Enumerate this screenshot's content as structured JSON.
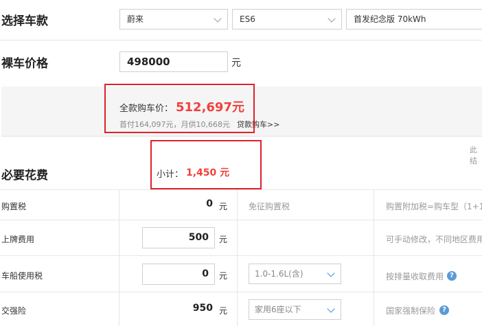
{
  "select_car": {
    "heading": "选择车款",
    "brand": "蔚来",
    "model": "ES6",
    "trim": "首发纪念版 70kWh"
  },
  "bare_price": {
    "heading": "裸车价格",
    "value": "498000",
    "unit": "元"
  },
  "summary": {
    "full_price_label": "全款购车价：",
    "full_price_value": "512,697元",
    "detail": "首付164,097元，月供10,668元",
    "loan_link": "贷款购车>>",
    "right_text": "此结"
  },
  "required": {
    "heading": "必要花费",
    "subtotal_label": "小计：",
    "subtotal_value": "1,450 元"
  },
  "rows": [
    {
      "label": "购置税",
      "value": "0",
      "unit": "元",
      "middle": "免征购置税",
      "note": "购置附加税=购车型（1+1"
    },
    {
      "label": "上牌费用",
      "value": "500",
      "unit": "元",
      "middle": "",
      "note": "可手动修改，不同地区费用"
    },
    {
      "label": "车船使用税",
      "value": "0",
      "unit": "元",
      "middle": "1.0-1.6L(含)",
      "note": "按排量收取费用"
    },
    {
      "label": "交强险",
      "value": "950",
      "unit": "元",
      "middle": "家用6座以下",
      "note": "国家强制保险"
    }
  ],
  "colors": {
    "accent_red": "#e0202a",
    "price_red": "#f0413d",
    "help_blue": "#5b9bd5"
  }
}
